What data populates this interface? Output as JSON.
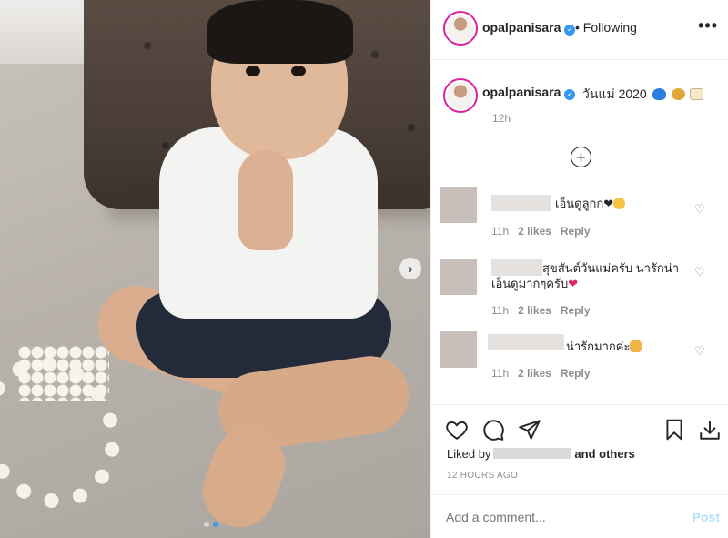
{
  "header": {
    "username": "opalpanisara",
    "separator": "•",
    "follow_status": "Following",
    "more_label": "•••"
  },
  "caption": {
    "username": "opalpanisara",
    "text": "วันแม่ 2020",
    "time": "12h"
  },
  "load_more_label": "+",
  "comments": [
    {
      "text": "เอ็นดูลูกก",
      "time": "11h",
      "likes": "2 likes",
      "reply": "Reply"
    },
    {
      "text_line1": "สุขสันต์วันแม่ครับ น่ารักน่า",
      "text_line2": "เอ็นดูมากๆครับ",
      "time": "11h",
      "likes": "2 likes",
      "reply": "Reply"
    },
    {
      "text": "น่ารักมากค่ะ",
      "time": "11h",
      "likes": "2 likes",
      "reply": "Reply"
    }
  ],
  "actions": {
    "liked_by_prefix": "Liked by",
    "liked_by_suffix": "and others",
    "post_time": "12 HOURS AGO"
  },
  "add_comment": {
    "placeholder": "Add a comment...",
    "post_label": "Post"
  },
  "colors": {
    "accent_blue": "#3897f0",
    "post_disabled": "#b2dffc",
    "muted_text": "#8e8e8e"
  },
  "carousel": {
    "next_icon": "›",
    "slide_count": 2,
    "active_slide": 2
  }
}
